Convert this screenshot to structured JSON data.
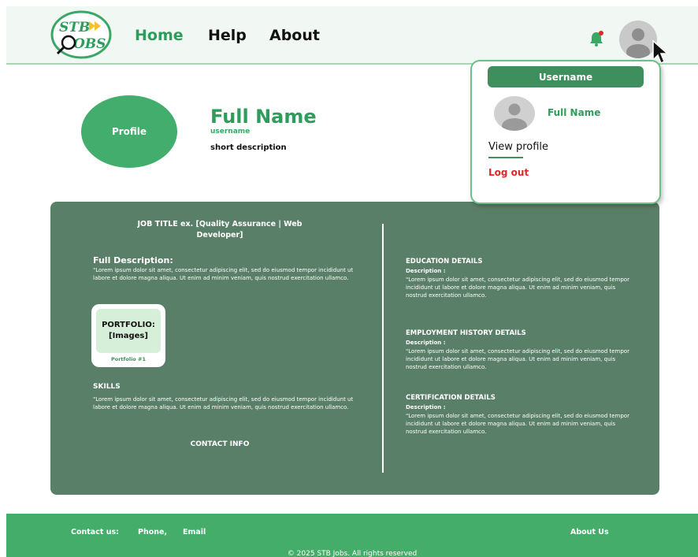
{
  "header": {
    "logo_text": "STB JOBS",
    "nav": {
      "home": "Home",
      "help": "Help",
      "about": "About"
    },
    "icons": {
      "notification": "bell-icon",
      "avatar": "user-avatar-icon",
      "cursor": "mouse-pointer-icon"
    },
    "notification_dot_color": "#e0262b"
  },
  "profile": {
    "circle_label": "Profile",
    "full_name": "Full Name",
    "username": "username",
    "short_description": "short description"
  },
  "dropdown": {
    "username": "Username",
    "full_name": "Full Name",
    "view_profile": "View profile",
    "log_out": "Log out"
  },
  "card": {
    "job_title": "JOB TITLE ex. [Quality Assurance | Web Developer]",
    "full_description_title": "Full Description:",
    "full_description_text": "\"Lorem ipsum dolor sit amet, consectetur adipiscing elit, sed do eiusmod tempor incididunt ut labore et dolore magna aliqua. Ut enim ad minim veniam, quis nostrud exercitation ullamco.",
    "portfolio": {
      "title": "PORTFOLIO:",
      "subtitle": "[Images]",
      "label": "Portfolio #1"
    },
    "skills_title": "SKILLS",
    "skills_text": "\"Lorem ipsum dolor sit amet, consectetur adipiscing elit, sed do eiusmod tempor incididunt ut labore et dolore magna aliqua. Ut enim ad minim veniam, quis nostrud exercitation ullamco.",
    "contact_info_title": "CONTACT INFO",
    "education": {
      "title": "EDUCATION DETAILS",
      "desc_label": "Description :",
      "text": "\"Lorem ipsum dolor sit amet, consectetur adipiscing elit, sed do eiusmod tempor incididunt ut labore et dolore magna aliqua. Ut enim ad minim veniam, quis nostrud exercitation ullamco."
    },
    "employment": {
      "title": "EMPLOYMENT HISTORY DETAILS",
      "desc_label": "Description :",
      "text": "\"Lorem ipsum dolor sit amet, consectetur adipiscing elit, sed do eiusmod tempor incididunt ut labore et dolore magna aliqua. Ut enim ad minim veniam, quis nostrud exercitation ullamco."
    },
    "certification": {
      "title": "CERTIFICATION DETAILS",
      "desc_label": "Description :",
      "text": "\"Lorem ipsum dolor sit amet, consectetur adipiscing elit, sed do eiusmod tempor incididunt ut labore et dolore magna aliqua. Ut enim ad minim veniam, quis nostrud exercitation ullamco."
    }
  },
  "footer": {
    "contact_label": "Contact us:",
    "phone": "Phone,",
    "email": "Email",
    "about_us": "About Us",
    "copyright": "© 2025 STB Jobs. All rights reserved"
  },
  "colors": {
    "brand_green": "#2f9c5b",
    "card_green": "#5a7f69",
    "footer_green": "#44ad6a",
    "danger_red": "#e0262b"
  }
}
